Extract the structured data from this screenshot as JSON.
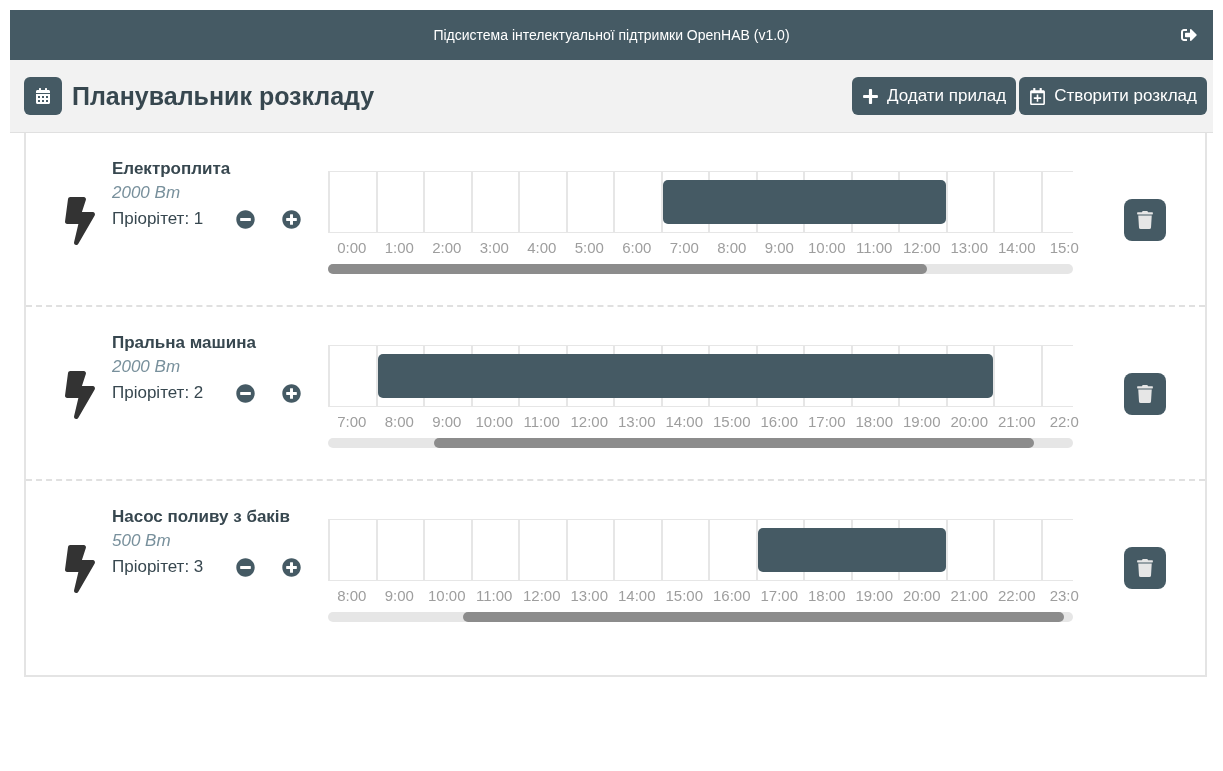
{
  "header": {
    "title": "Підсистема інтелектуальної підтримки OpenHAB (v1.0)"
  },
  "toolbar": {
    "title": "Планувальник розкладу",
    "buttons": [
      {
        "kind": "add",
        "label": "Додати прилад"
      },
      {
        "kind": "schedule",
        "label": "Створити розклад"
      }
    ]
  },
  "devices": [
    {
      "name": "Електроплита",
      "power": "2000 Вт",
      "priority": "Пріорітет: 1",
      "slots": [
        {
          "label": "0:00",
          "busy": false
        },
        {
          "label": "1:00",
          "busy": false
        },
        {
          "label": "2:00",
          "busy": false
        },
        {
          "label": "3:00",
          "busy": false
        },
        {
          "label": "4:00",
          "busy": false
        },
        {
          "label": "5:00",
          "busy": false
        },
        {
          "label": "6:00",
          "busy": false
        },
        {
          "label": "7:00",
          "busy": true
        },
        {
          "label": "8:00",
          "busy": true
        },
        {
          "label": "9:00",
          "busy": true
        },
        {
          "label": "10:00",
          "busy": true
        },
        {
          "label": "11:00",
          "busy": true
        },
        {
          "label": "12:00",
          "busy": true
        },
        {
          "label": "13:00",
          "busy": false
        },
        {
          "label": "14:00",
          "busy": false
        },
        {
          "label": "15:0",
          "busy": false
        }
      ]
    },
    {
      "name": "Пральна машина",
      "power": "2000 Вт",
      "priority": "Пріорітет: 2",
      "slots": [
        {
          "label": "7:00",
          "busy": false
        },
        {
          "label": "8:00",
          "busy": true
        },
        {
          "label": "9:00",
          "busy": true
        },
        {
          "label": "10:00",
          "busy": true
        },
        {
          "label": "11:00",
          "busy": true
        },
        {
          "label": "12:00",
          "busy": true
        },
        {
          "label": "13:00",
          "busy": true
        },
        {
          "label": "14:00",
          "busy": true
        },
        {
          "label": "15:00",
          "busy": true
        },
        {
          "label": "16:00",
          "busy": true
        },
        {
          "label": "17:00",
          "busy": true
        },
        {
          "label": "18:00",
          "busy": true
        },
        {
          "label": "19:00",
          "busy": true
        },
        {
          "label": "20:00",
          "busy": true
        },
        {
          "label": "21:00",
          "busy": false
        },
        {
          "label": "22:0",
          "busy": false
        }
      ]
    },
    {
      "name": "Насос поливу з баків",
      "power": "500 Вт",
      "priority": "Пріорітет: 3",
      "slots": [
        {
          "label": "8:00",
          "busy": false
        },
        {
          "label": "9:00",
          "busy": false
        },
        {
          "label": "10:00",
          "busy": false
        },
        {
          "label": "11:00",
          "busy": false
        },
        {
          "label": "12:00",
          "busy": false
        },
        {
          "label": "13:00",
          "busy": false
        },
        {
          "label": "14:00",
          "busy": false
        },
        {
          "label": "15:00",
          "busy": false
        },
        {
          "label": "16:00",
          "busy": false
        },
        {
          "label": "17:00",
          "busy": true
        },
        {
          "label": "18:00",
          "busy": true
        },
        {
          "label": "19:00",
          "busy": true
        },
        {
          "label": "20:00",
          "busy": true
        },
        {
          "label": "21:00",
          "busy": false
        },
        {
          "label": "22:00",
          "busy": false
        },
        {
          "label": "23:0",
          "busy": false
        }
      ]
    }
  ]
}
